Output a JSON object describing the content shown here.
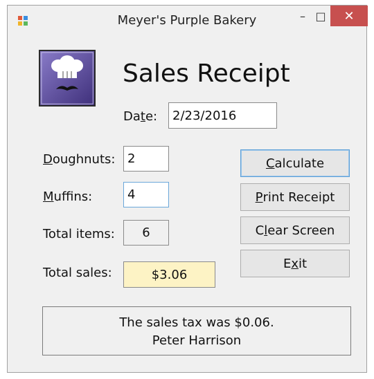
{
  "window": {
    "title": "Meyer's Purple Bakery",
    "controls": {
      "minimize": "–",
      "maximize": "□",
      "close": "✕"
    }
  },
  "header": {
    "title": "Sales Receipt"
  },
  "date": {
    "label_pre": "Da",
    "label_key": "t",
    "label_post": "e:",
    "value": "2/23/2016"
  },
  "doughnuts": {
    "label_key": "D",
    "label_rest": "oughnuts:",
    "value": "2"
  },
  "muffins": {
    "label_key": "M",
    "label_rest": "uffins:",
    "value": "4"
  },
  "total_items": {
    "label": "Total items:",
    "value": "6"
  },
  "total_sales": {
    "label": "Total sales:",
    "value": "$3.06"
  },
  "buttons": {
    "calculate": {
      "key": "C",
      "rest": "alculate"
    },
    "print": {
      "key": "P",
      "rest": "rint Receipt"
    },
    "clear": {
      "pre": "C",
      "key": "l",
      "rest": "ear Screen"
    },
    "exit": {
      "pre": "E",
      "key": "x",
      "rest": "it"
    }
  },
  "message": {
    "line1": "The sales tax was $0.06.",
    "line2": "Peter Harrison"
  },
  "colors": {
    "logo_purple": "#5b4a99",
    "total_sales_bg": "#fdf3c5",
    "close_button": "#c7504f",
    "default_button_border": "#5ea0d8"
  }
}
